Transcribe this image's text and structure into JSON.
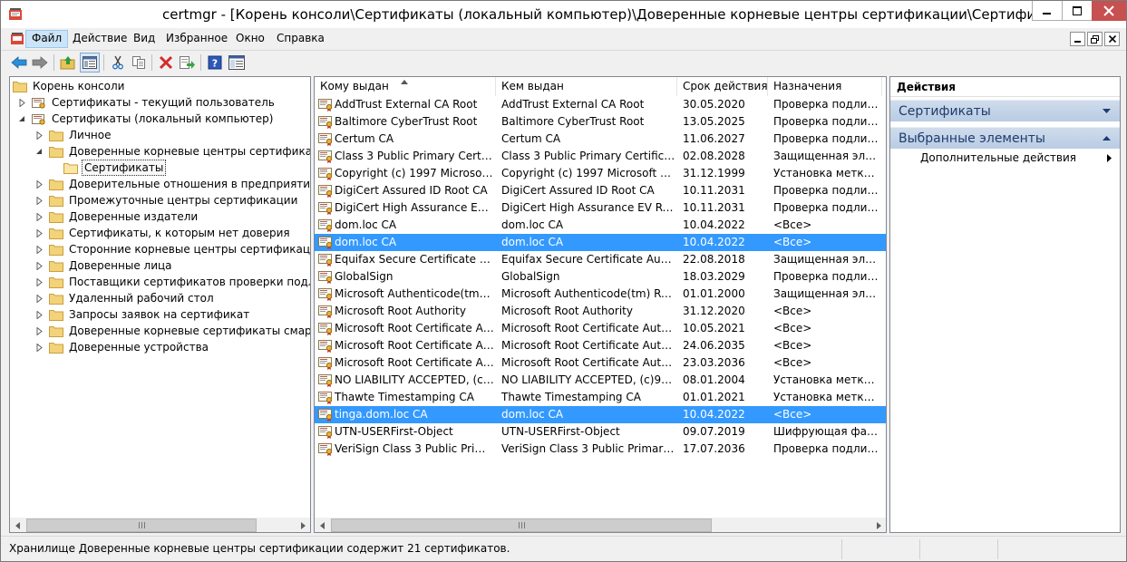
{
  "window": {
    "title": "certmgr - [Корень консоли\\Сертификаты (локальный компьютер)\\Доверенные корневые центры сертификации\\Сертификаты]",
    "minimize_icon": "minimize-icon",
    "maximize_icon": "maximize-icon",
    "close_icon": "close-icon"
  },
  "menu": {
    "items": [
      "Файл",
      "Действие",
      "Вид",
      "Избранное",
      "Окно",
      "Справка"
    ],
    "active": "Файл"
  },
  "toolbar": {
    "icons": [
      "back-arrow-icon",
      "forward-arrow-icon",
      "up-folder-icon",
      "show-hide-tree-icon",
      "cut-icon",
      "copy-icon",
      "delete-icon",
      "export-list-icon",
      "help-icon",
      "properties-icon"
    ]
  },
  "tree": {
    "root": "Корень консоли",
    "current_user": "Сертификаты - текущий пользователь",
    "local_computer": "Сертификаты (локальный компьютер)",
    "personal": "Личное",
    "trusted_root": "Доверенные корневые центры сертификации",
    "certificates": "Сертификаты",
    "children": [
      "Доверительные отношения в предприятии",
      "Промежуточные центры сертификации",
      "Доверенные издатели",
      "Сертификаты, к которым нет доверия",
      "Сторонние корневые центры сертификации",
      "Доверенные лица",
      "Поставщики сертификатов проверки подлинности",
      "Удаленный рабочий стол",
      "Запросы заявок на сертификат",
      "Доверенные корневые сертификаты смарт-карт",
      "Доверенные устройства"
    ]
  },
  "list": {
    "columns": [
      "Кому выдан",
      "Кем выдан",
      "Срок действия",
      "Назначения"
    ],
    "rows": [
      {
        "to": "AddTrust External CA Root",
        "by": "AddTrust External CA Root",
        "exp": "30.05.2020",
        "purpose": "Проверка подлин...",
        "sel": false
      },
      {
        "to": "Baltimore CyberTrust Root",
        "by": "Baltimore CyberTrust Root",
        "exp": "13.05.2025",
        "purpose": "Проверка подлин...",
        "sel": false
      },
      {
        "to": "Certum CA",
        "by": "Certum CA",
        "exp": "11.06.2027",
        "purpose": "Проверка подлин...",
        "sel": false
      },
      {
        "to": "Class 3 Public Primary Certificat...",
        "by": "Class 3 Public Primary Certificatio...",
        "exp": "02.08.2028",
        "purpose": "Защищенная элек...",
        "sel": false
      },
      {
        "to": "Copyright (c) 1997 Microsoft C...",
        "by": "Copyright (c) 1997 Microsoft Corp.",
        "exp": "31.12.1999",
        "purpose": "Установка метки в...",
        "sel": false
      },
      {
        "to": "DigiCert Assured ID Root CA",
        "by": "DigiCert Assured ID Root CA",
        "exp": "10.11.2031",
        "purpose": "Проверка подлин...",
        "sel": false
      },
      {
        "to": "DigiCert High Assurance EV Ro...",
        "by": "DigiCert High Assurance EV Root ...",
        "exp": "10.11.2031",
        "purpose": "Проверка подлин...",
        "sel": false
      },
      {
        "to": "dom.loc CA",
        "by": "dom.loc CA",
        "exp": "10.04.2022",
        "purpose": "<Все>",
        "sel": false
      },
      {
        "to": "dom.loc CA",
        "by": "dom.loc CA",
        "exp": "10.04.2022",
        "purpose": "<Все>",
        "sel": true
      },
      {
        "to": "Equifax Secure Certificate Auth...",
        "by": "Equifax Secure Certificate Authority",
        "exp": "22.08.2018",
        "purpose": "Защищенная элек...",
        "sel": false
      },
      {
        "to": "GlobalSign",
        "by": "GlobalSign",
        "exp": "18.03.2029",
        "purpose": "Проверка подлин...",
        "sel": false
      },
      {
        "to": "Microsoft Authenticode(tm) Ro...",
        "by": "Microsoft Authenticode(tm) Root...",
        "exp": "01.01.2000",
        "purpose": "Защищенная элек...",
        "sel": false
      },
      {
        "to": "Microsoft Root Authority",
        "by": "Microsoft Root Authority",
        "exp": "31.12.2020",
        "purpose": "<Все>",
        "sel": false
      },
      {
        "to": "Microsoft Root Certificate Auth...",
        "by": "Microsoft Root Certificate Authori...",
        "exp": "10.05.2021",
        "purpose": "<Все>",
        "sel": false
      },
      {
        "to": "Microsoft Root Certificate Auth...",
        "by": "Microsoft Root Certificate Authori...",
        "exp": "24.06.2035",
        "purpose": "<Все>",
        "sel": false
      },
      {
        "to": "Microsoft Root Certificate Auth...",
        "by": "Microsoft Root Certificate Authori...",
        "exp": "23.03.2036",
        "purpose": "<Все>",
        "sel": false
      },
      {
        "to": "NO LIABILITY ACCEPTED, (c)97 ...",
        "by": "NO LIABILITY ACCEPTED, (c)97 V...",
        "exp": "08.01.2004",
        "purpose": "Установка метки в...",
        "sel": false
      },
      {
        "to": "Thawte Timestamping CA",
        "by": "Thawte Timestamping CA",
        "exp": "01.01.2021",
        "purpose": "Установка метки в...",
        "sel": false
      },
      {
        "to": "tinga.dom.loc CA",
        "by": "dom.loc CA",
        "exp": "10.04.2022",
        "purpose": "<Все>",
        "sel": true
      },
      {
        "to": "UTN-USERFirst-Object",
        "by": "UTN-USERFirst-Object",
        "exp": "09.07.2019",
        "purpose": "Шифрующая фай...",
        "sel": false
      },
      {
        "to": "VeriSign Class 3 Public Primary ...",
        "by": "VeriSign Class 3 Public Primary Ce...",
        "exp": "17.07.2036",
        "purpose": "Проверка подлин...",
        "sel": false
      }
    ]
  },
  "actions": {
    "title": "Действия",
    "group1": "Сертификаты",
    "group2": "Выбранные элементы",
    "more": "Дополнительные действия"
  },
  "status": {
    "text": "Хранилище Доверенные корневые центры сертификации содержит 21 сертификатов."
  },
  "colors": {
    "selection": "#3399ff",
    "close_button": "#c75050",
    "action_header": "#b9cce3"
  }
}
